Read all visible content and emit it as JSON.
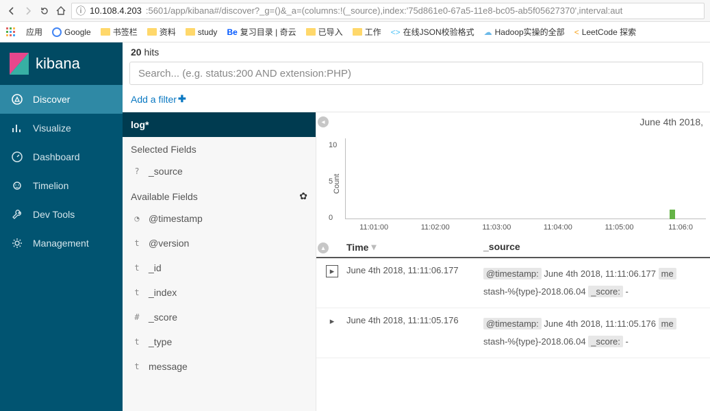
{
  "browser": {
    "url_host": "10.108.4.203",
    "url_port_path": ":5601/app/kibana#/discover?_g=()&_a=(columns:!(_source),index:'75d861e0-67a5-11e8-bc05-ab5f05627370',interval:aut",
    "bookmarks": {
      "apps": "应用",
      "google": "Google",
      "b1": "书签栏",
      "b2": "资料",
      "b3": "study",
      "b4": "复习目录 | 奇云",
      "b5": "已导入",
      "b6": "工作",
      "b7": "在线JSON校验格式",
      "b8": "Hadoop实操的全部",
      "b9": "LeetCode 探索"
    }
  },
  "brand": "kibana",
  "nav": {
    "discover": "Discover",
    "visualize": "Visualize",
    "dashboard": "Dashboard",
    "timelion": "Timelion",
    "devtools": "Dev Tools",
    "management": "Management"
  },
  "hits": {
    "count": "20",
    "label": " hits"
  },
  "search": {
    "placeholder": "Search... (e.g. status:200 AND extension:PHP)"
  },
  "filter": {
    "add": "Add a filter "
  },
  "index_pattern": "log*",
  "fields": {
    "selected_title": "Selected Fields",
    "available_title": "Available Fields",
    "selected": [
      {
        "type": "?",
        "name": "_source"
      }
    ],
    "available": [
      {
        "type": "clock",
        "name": "@timestamp"
      },
      {
        "type": "t",
        "name": "@version"
      },
      {
        "type": "t",
        "name": "_id"
      },
      {
        "type": "t",
        "name": "_index"
      },
      {
        "type": "#",
        "name": "_score"
      },
      {
        "type": "t",
        "name": "_type"
      },
      {
        "type": "t",
        "name": "message"
      }
    ]
  },
  "time_range": "June 4th 2018, ",
  "chart_data": {
    "type": "bar",
    "ylabel": "Count",
    "yticks": [
      "10",
      "5",
      "0"
    ],
    "xticks": [
      "11:01:00",
      "11:02:00",
      "11:03:00",
      "11:04:00",
      "11:05:00",
      "11:06:0"
    ],
    "bar": {
      "x_pct": 90,
      "height": 14
    }
  },
  "table": {
    "headers": {
      "time": "Time",
      "source": "_source"
    },
    "rows": [
      {
        "time": "June 4th 2018, 11:11:06.177",
        "ts_label": "@timestamp:",
        "ts_val": " June 4th 2018, 11:11:06.177 ",
        "me": "me",
        "line2a": "stash-%{type}-2018.06.04 ",
        "score_label": "_score:",
        "score_val": " - "
      },
      {
        "time": "June 4th 2018, 11:11:05.176",
        "ts_label": "@timestamp:",
        "ts_val": " June 4th 2018, 11:11:05.176 ",
        "me": "me",
        "line2a": "stash-%{type}-2018.06.04 ",
        "score_label": "_score:",
        "score_val": " - "
      }
    ]
  }
}
